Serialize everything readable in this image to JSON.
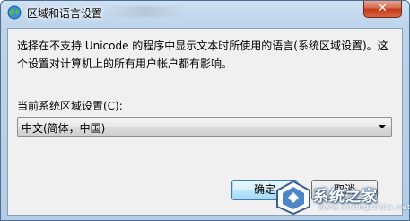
{
  "window": {
    "title": "区域和语言设置",
    "close_icon": "close-icon"
  },
  "dialog": {
    "description": "选择在不支持 Unicode 的程序中显示文本时所使用的语言(系统区域设置)。这个设置对计算机上的所有用户帐户都有影响。",
    "locale_label": "当前系统区域设置(C):",
    "locale_value": "中文(简体，中国)",
    "ok_label": "确定",
    "cancel_label": "取消"
  },
  "watermark": {
    "text": "系统之家",
    "url": "www.xitongzhijia.net"
  },
  "colors": {
    "title_bar": "#bcd3ea",
    "close_button": "#c4391a",
    "client_bg": "#f0f0f0",
    "default_button_border": "#3c7fb1"
  }
}
